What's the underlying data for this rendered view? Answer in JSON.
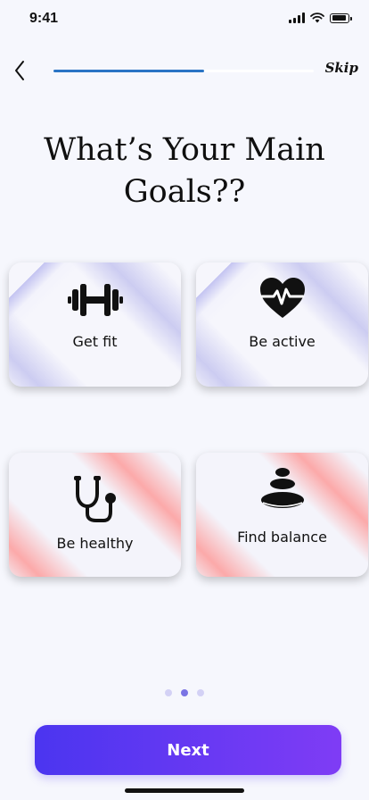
{
  "status_bar": {
    "time": "9:41"
  },
  "header": {
    "back_icon": "chevron-left-icon",
    "skip_label": "Skip",
    "progress": 0.58
  },
  "title": "What’s Your Main Goals??",
  "goals": [
    {
      "label": "Get fit",
      "icon": "dumbbell-icon"
    },
    {
      "label": "Be active",
      "icon": "heart-pulse-icon"
    },
    {
      "label": "Be healthy",
      "icon": "stethoscope-icon"
    },
    {
      "label": "Find balance",
      "icon": "stacked-stones-icon"
    }
  ],
  "pagination": {
    "count": 3,
    "active": 2
  },
  "next_label": "Next",
  "colors": {
    "progress": "#2a74c5",
    "button_start": "#4b35f0",
    "button_end": "#7f3cf5",
    "card_accent_purple": "#c8c8f0",
    "card_accent_red": "#fca5a5"
  }
}
